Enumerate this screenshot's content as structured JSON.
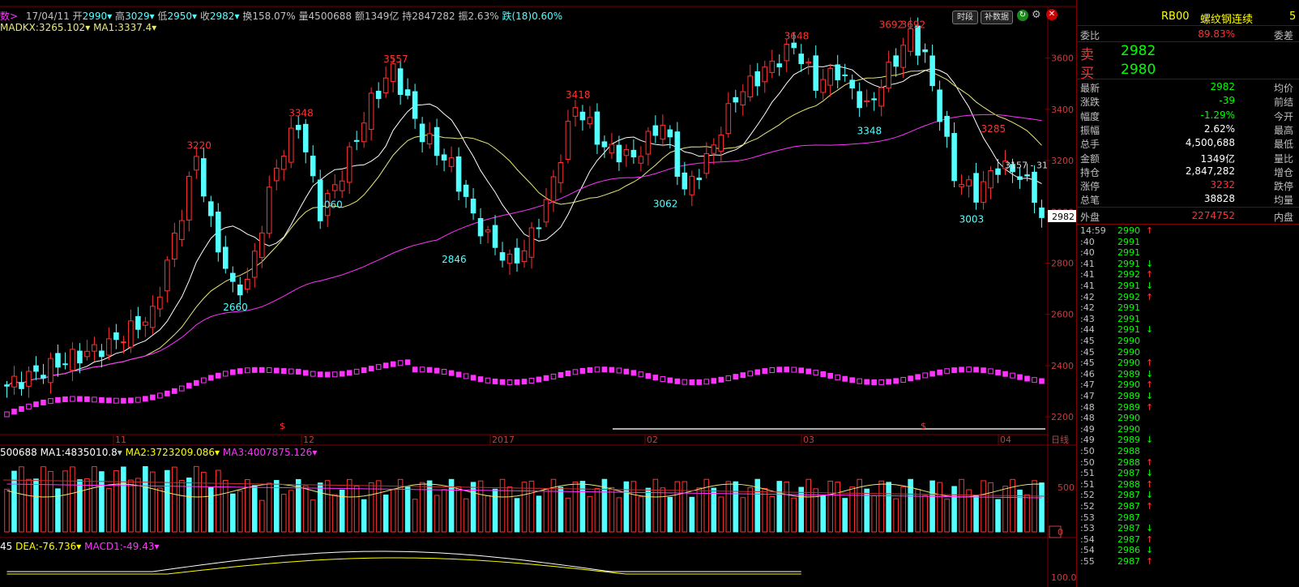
{
  "header": {
    "prefix": "数>",
    "date": "17/04/11",
    "open_l": "开",
    "open_v": "2990",
    "high_l": "高",
    "high_v": "3029",
    "low_l": "低",
    "low_v": "2950",
    "close_l": "收",
    "close_v": "2982",
    "turnover": "换158.07%",
    "volume": "量4500688",
    "amount": "额1349亿",
    "hold": "持2847282",
    "amplitude": "振2.63%",
    "change": "跌(18)0.60%"
  },
  "ma_header": {
    "madkx": "MADKX:3265.102",
    "ma1": "MA1:3337.4"
  },
  "vol_header": {
    "vol": "500688",
    "ma1": "MA1:4835010.8",
    "ma2": "MA2:3723209.086",
    "ma3": "MA3:4007875.126"
  },
  "macd_header": {
    "dif": "45",
    "dea": "DEA:-76.736",
    "macd": "MACD1:-49.43"
  },
  "buttons": {
    "period": "时段",
    "supplement": "补数据"
  },
  "price_labels": [
    "3600",
    "3400",
    "3200",
    "3000",
    "2800",
    "2600",
    "2400",
    "2200"
  ],
  "current_price_tag": "2982",
  "vol_labels": [
    "500",
    "0"
  ],
  "macd_label": "100.0",
  "x_labels": [
    "11",
    "12",
    "2017",
    "02",
    "03",
    "04"
  ],
  "x_end_label": "日线",
  "hilo_labels": [
    {
      "text": "3220",
      "type": "high"
    },
    {
      "text": "3348",
      "type": "high"
    },
    {
      "text": "3557",
      "type": "high"
    },
    {
      "text": "3418",
      "type": "high"
    },
    {
      "text": "3648",
      "type": "high"
    },
    {
      "text": "3692",
      "type": "high"
    },
    {
      "text": "3692",
      "type": "high"
    },
    {
      "text": "3285",
      "type": "high"
    },
    {
      "text": "2660",
      "type": "low"
    },
    {
      "text": "3060",
      "type": "low"
    },
    {
      "text": "2846",
      "type": "low"
    },
    {
      "text": "3062",
      "type": "low"
    },
    {
      "text": "3348",
      "type": "low"
    },
    {
      "text": "3003",
      "type": "low"
    }
  ],
  "ruler_text": "3157 - 31",
  "dollar_sign": "$",
  "panel": {
    "code": "RB00",
    "name": "螺纹钢连续",
    "suffix": "5",
    "weibi_l": "委比",
    "weibi_v": "89.83%",
    "weicha_l": "委差",
    "sell_l": "卖",
    "sell_v": "2982",
    "buy_l": "买",
    "buy_v": "2980",
    "stats": [
      {
        "l": "最新",
        "v": "2982",
        "r": "均价"
      },
      {
        "l": "涨跌",
        "v": "-39",
        "r": "前结"
      },
      {
        "l": "幅度",
        "v": "-1.29%",
        "r": "今开"
      },
      {
        "l": "振幅",
        "v": "2.62%",
        "r": "最高"
      },
      {
        "l": "总手",
        "v": "4,500,688",
        "r": "最低"
      },
      {
        "l": "金额",
        "v": "1349亿",
        "r": "量比"
      },
      {
        "l": "持仓",
        "v": "2,847,282",
        "r": "增仓"
      },
      {
        "l": "涨停",
        "v": "3232",
        "r": "跌停"
      },
      {
        "l": "总笔",
        "v": "38828",
        "r": "均量"
      }
    ],
    "outer_l": "外盘",
    "outer_v": "2274752",
    "inner_l": "内盘",
    "ticks": [
      {
        "t": "14:59",
        "p": "2990",
        "d": "↑"
      },
      {
        "t": ":40",
        "p": "2991",
        "d": ""
      },
      {
        "t": ":40",
        "p": "2991",
        "d": ""
      },
      {
        "t": ":41",
        "p": "2991",
        "d": "↓"
      },
      {
        "t": ":41",
        "p": "2992",
        "d": "↑"
      },
      {
        "t": ":41",
        "p": "2991",
        "d": "↓"
      },
      {
        "t": ":42",
        "p": "2992",
        "d": "↑"
      },
      {
        "t": ":42",
        "p": "2991",
        "d": ""
      },
      {
        "t": ":43",
        "p": "2991",
        "d": ""
      },
      {
        "t": ":44",
        "p": "2991",
        "d": "↓"
      },
      {
        "t": ":45",
        "p": "2990",
        "d": ""
      },
      {
        "t": ":45",
        "p": "2990",
        "d": ""
      },
      {
        "t": ":45",
        "p": "2990",
        "d": "↑"
      },
      {
        "t": ":46",
        "p": "2989",
        "d": "↓"
      },
      {
        "t": ":47",
        "p": "2990",
        "d": "↑"
      },
      {
        "t": ":47",
        "p": "2989",
        "d": "↓"
      },
      {
        "t": ":48",
        "p": "2989",
        "d": "↑"
      },
      {
        "t": ":48",
        "p": "2990",
        "d": ""
      },
      {
        "t": ":49",
        "p": "2990",
        "d": ""
      },
      {
        "t": ":49",
        "p": "2989",
        "d": "↓"
      },
      {
        "t": ":50",
        "p": "2988",
        "d": ""
      },
      {
        "t": ":50",
        "p": "2988",
        "d": "↑"
      },
      {
        "t": ":51",
        "p": "2987",
        "d": "↓"
      },
      {
        "t": ":51",
        "p": "2988",
        "d": "↑"
      },
      {
        "t": ":52",
        "p": "2987",
        "d": "↓"
      },
      {
        "t": ":52",
        "p": "2987",
        "d": "↑"
      },
      {
        "t": ":53",
        "p": "2987",
        "d": ""
      },
      {
        "t": ":53",
        "p": "2987",
        "d": "↓"
      },
      {
        "t": ":54",
        "p": "2987",
        "d": "↑"
      },
      {
        "t": ":54",
        "p": "2986",
        "d": "↓"
      },
      {
        "t": ":55",
        "p": "2987",
        "d": "↑"
      }
    ]
  },
  "colors": {
    "up": "#ff3232",
    "down": "#54ffff",
    "ma_yellow": "#e8e87a",
    "ma_white": "#ffffff",
    "ma_magenta": "#ff33ff",
    "text_green": "#00ff00",
    "text_yellow": "#ffff00",
    "grid": "#800000"
  },
  "chart_data": {
    "type": "candlestick",
    "ylim": [
      2150,
      3700
    ],
    "hi_lo_marks": {
      "highs": [
        3220,
        3348,
        3557,
        3418,
        3648,
        3692,
        3285
      ],
      "lows": [
        2660,
        3060,
        2846,
        3062,
        3348,
        3003
      ]
    },
    "last_close": 2982
  }
}
